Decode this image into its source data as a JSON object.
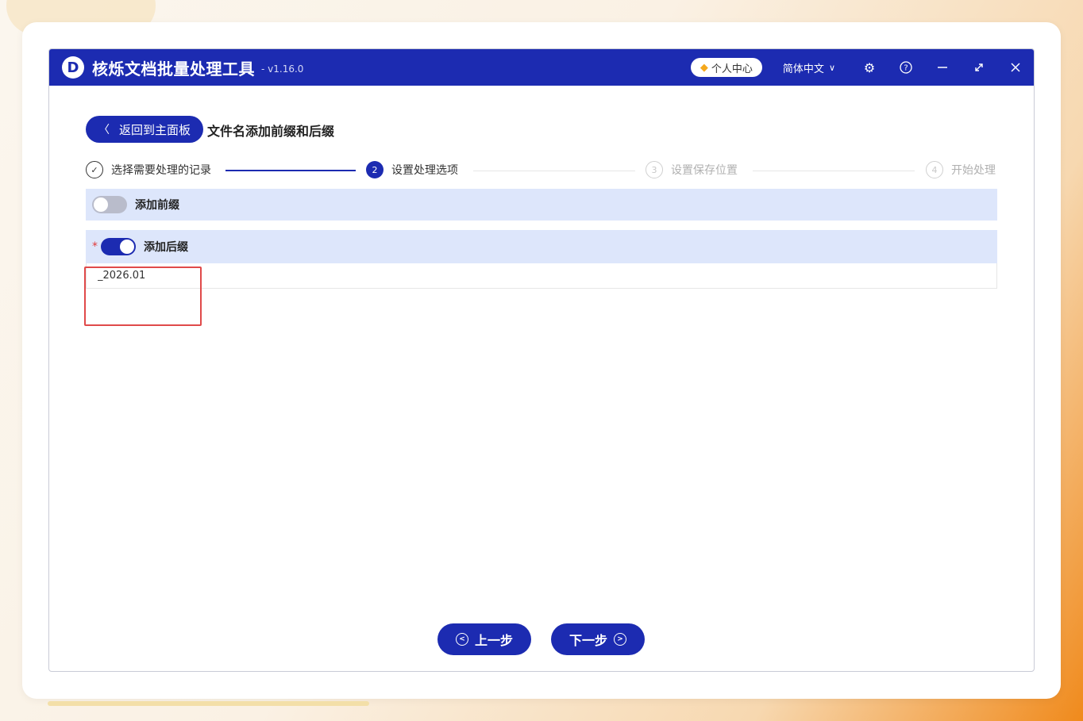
{
  "app": {
    "title": "核烁文档批量处理工具",
    "version": "- v1.16.0",
    "logo_letter": "D"
  },
  "titlebar": {
    "vip_label": "个人中心",
    "language": "简体中文",
    "icons": [
      "diamond-icon",
      "chevron-down-icon",
      "gear-icon",
      "help-icon",
      "minimize-icon",
      "maximize-icon",
      "close-icon"
    ]
  },
  "nav": {
    "back_label": "返回到主面板",
    "page_title": "文件名添加前缀和后缀"
  },
  "steps": [
    {
      "num": "✓",
      "label": "选择需要处理的记录",
      "state": "done"
    },
    {
      "num": "2",
      "label": "设置处理选项",
      "state": "active"
    },
    {
      "num": "3",
      "label": "设置保存位置",
      "state": "todo"
    },
    {
      "num": "4",
      "label": "开始处理",
      "state": "todo"
    }
  ],
  "options": {
    "prefix": {
      "label": "添加前缀",
      "enabled": false
    },
    "suffix": {
      "label": "添加后缀",
      "enabled": true,
      "required_mark": "*",
      "value": "_2026.01"
    }
  },
  "footer": {
    "prev_label": "上一步",
    "next_label": "下一步"
  },
  "colors": {
    "primary": "#1c2bb1",
    "option_bg": "#dde6fb",
    "highlight": "#e04a4a"
  }
}
